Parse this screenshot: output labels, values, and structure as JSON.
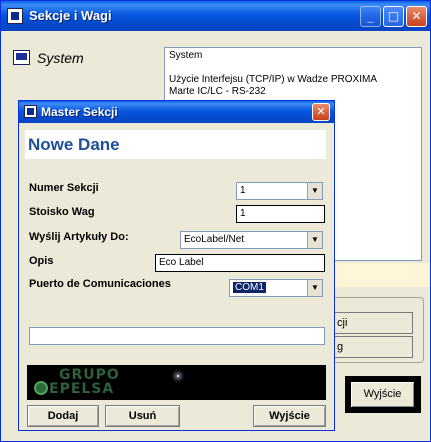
{
  "main_window": {
    "title": "Sekcje i Wagi",
    "tree_item": "System",
    "info_lines": [
      "System",
      "",
      "Użycie Interfejsu (TCP/IP) w Wadze PROXIMA",
      "Marte IC/LC - RS-232"
    ],
    "side_buttons": [
      "cji",
      "g"
    ],
    "exit_button": "Wyjście",
    "caption_buttons": {
      "minimize": "_",
      "maximize": "□",
      "close": "✕"
    }
  },
  "dialog": {
    "title": "Master Sekcji",
    "header": "Nowe Dane",
    "close_glyph": "✕",
    "fields": {
      "numer_sekcji": {
        "label": "Numer Sekcji",
        "value": "1"
      },
      "stoisko_wag": {
        "label": "Stoisko Wag",
        "value": "1"
      },
      "wyslij_artykuly": {
        "label": "Wyślij Artykuły Do:",
        "value": "EcoLabel/Net"
      },
      "opis": {
        "label": "Opis",
        "value": "Eco Label"
      },
      "puerto": {
        "label": "Puerto de Comunicaciones",
        "value": "COM1"
      }
    },
    "logo": {
      "line1": "GRUPO",
      "line2": "EPELSA"
    },
    "buttons": {
      "add": "Dodaj",
      "delete": "Usuń",
      "exit": "Wyjście"
    }
  },
  "colors": {
    "titlebar": "#0857e1",
    "header_text": "#1f4f9a",
    "selection": "#0b246a",
    "logo_text": "#2f5f3a"
  }
}
